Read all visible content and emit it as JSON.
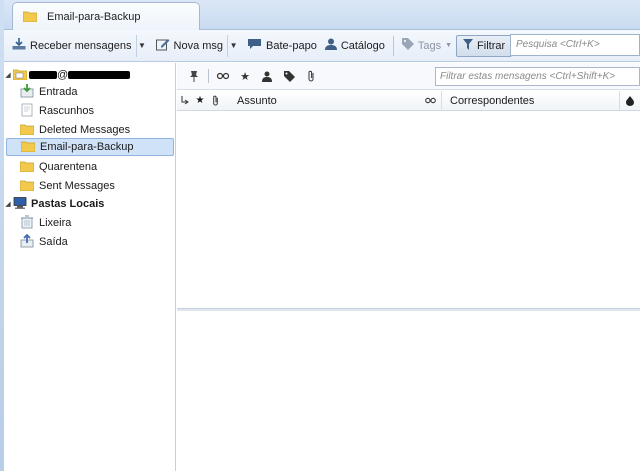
{
  "tab": {
    "title": "Email-para-Backup"
  },
  "toolbar": {
    "get_messages": "Receber mensagens",
    "new_msg": "Nova msg",
    "chat": "Bate-papo",
    "address_book": "Catálogo",
    "tags": "Tags",
    "filter": "Filtrar",
    "search_placeholder": "Pesquisa <Ctrl+K>"
  },
  "folders": {
    "account_suffix": "@",
    "items": [
      {
        "label": "Entrada",
        "icon": "inbox-icon"
      },
      {
        "label": "Rascunhos",
        "icon": "drafts-icon"
      },
      {
        "label": "Deleted Messages",
        "icon": "folder-icon"
      },
      {
        "label": "Email-para-Backup",
        "icon": "folder-icon",
        "selected": true
      },
      {
        "label": "Quarentena",
        "icon": "folder-icon"
      },
      {
        "label": "Sent Messages",
        "icon": "folder-icon"
      }
    ],
    "local": {
      "label": "Pastas Locais",
      "items": [
        {
          "label": "Lixeira",
          "icon": "trash-icon"
        },
        {
          "label": "Saída",
          "icon": "outbox-icon"
        }
      ]
    }
  },
  "quickfilter": {
    "placeholder": "Filtrar estas mensagens <Ctrl+Shift+K>"
  },
  "columns": {
    "subject": "Assunto",
    "correspondents": "Correspondentes"
  },
  "colors": {
    "accent": "#cfe2f8",
    "folder_yellow": "#f2c94c",
    "toolbar_bg": "#e7eef8"
  }
}
